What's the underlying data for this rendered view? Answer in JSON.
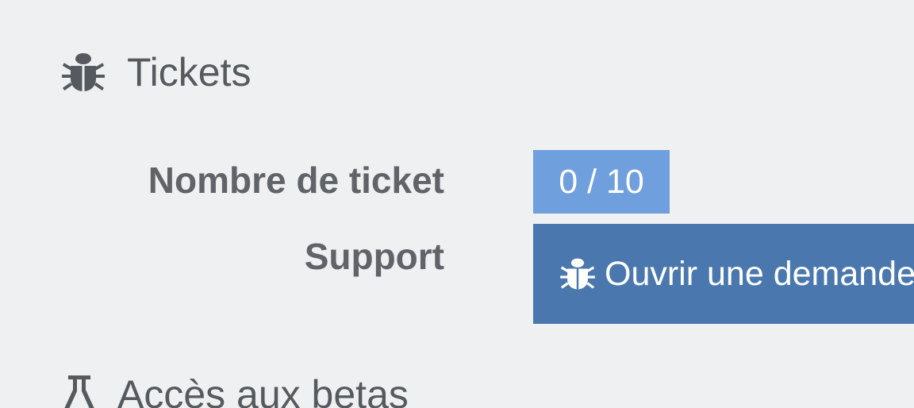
{
  "tickets": {
    "title": "Tickets",
    "icon": "bug-icon",
    "count_label": "Nombre de ticket",
    "count_value": "0 / 10",
    "support_label": "Support",
    "support_button_label": "Ouvrir une demande",
    "support_button_icon": "bug-icon"
  },
  "betas": {
    "title": "Accès aux betas",
    "icon": "flask-icon"
  },
  "colors": {
    "background": "#eff0f2",
    "badge": "#6f9fdd",
    "button": "#4a78ae",
    "text": "#555a5f"
  }
}
